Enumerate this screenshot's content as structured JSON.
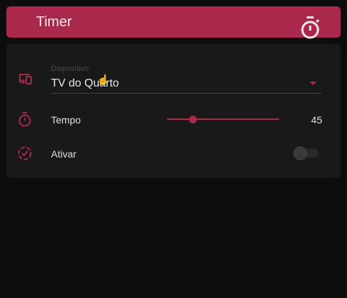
{
  "header": {
    "title": "Timer",
    "icon": "timer-icon"
  },
  "colors": {
    "accent": "#a8294b",
    "background": "#0d0d0d",
    "card": "#191919"
  },
  "device": {
    "label": "Dispositivo",
    "value": "TV do Quarto",
    "icon": "devices-icon"
  },
  "time": {
    "label": "Tempo",
    "value": "45",
    "slider_fraction": 0.23,
    "icon": "timer-icon"
  },
  "activate": {
    "label": "Ativar",
    "checked": false,
    "icon": "timer-check-icon"
  }
}
